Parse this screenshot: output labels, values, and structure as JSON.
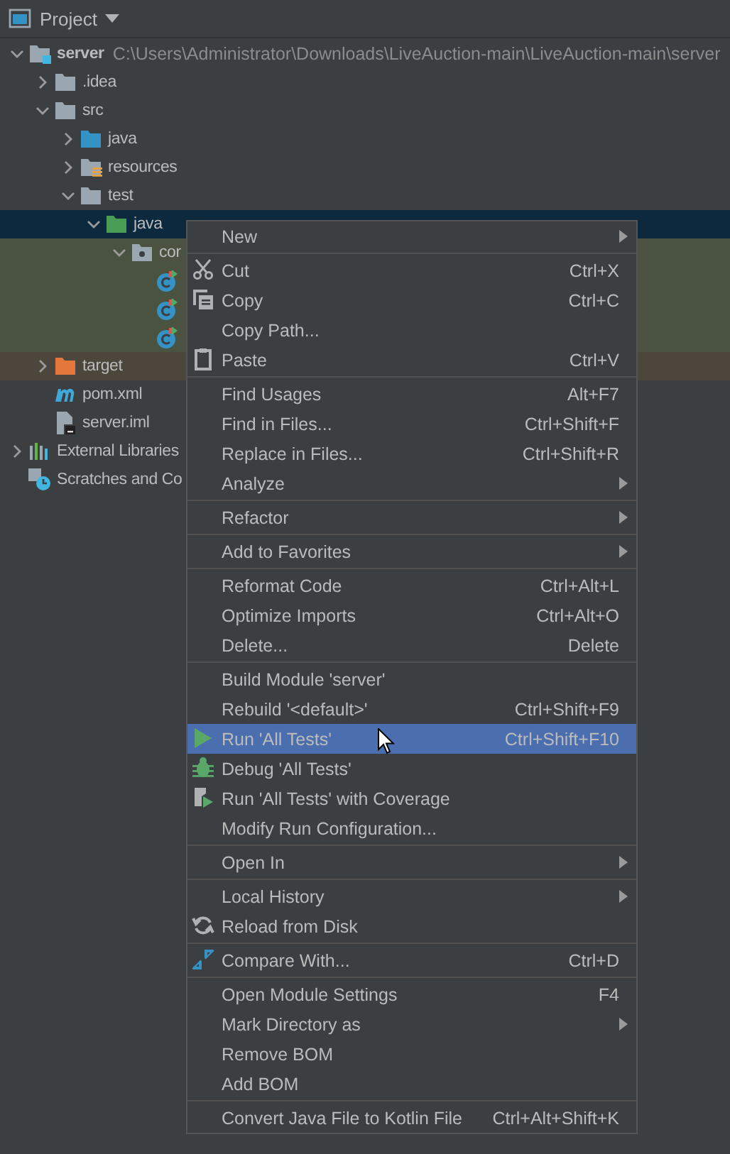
{
  "panel": {
    "title": "Project"
  },
  "tree": [
    {
      "kind": "module",
      "label": "server",
      "path": "C:\\Users\\Administrator\\Downloads\\LiveAuction-main\\LiveAuction-main\\server",
      "expanded": true,
      "selected": false,
      "children": [
        {
          "kind": "folder",
          "label": ".idea",
          "expanded": false,
          "selected": false
        },
        {
          "kind": "folder",
          "label": "src",
          "expanded": true,
          "selected": false,
          "children": [
            {
              "kind": "source-folder",
              "label": "java",
              "expanded": false,
              "selected": false
            },
            {
              "kind": "resources-folder",
              "label": "resources",
              "expanded": false,
              "selected": false
            },
            {
              "kind": "folder",
              "label": "test",
              "expanded": true,
              "selected": false,
              "children": [
                {
                  "kind": "test-folder",
                  "label": "java",
                  "expanded": true,
                  "selected": true,
                  "children": [
                    {
                      "kind": "package",
                      "label": "cor",
                      "expanded": true,
                      "selected": false,
                      "test": true,
                      "children": [
                        {
                          "kind": "test-class",
                          "selected": false,
                          "test": true
                        },
                        {
                          "kind": "test-class",
                          "selected": false,
                          "test": true
                        },
                        {
                          "kind": "test-class",
                          "selected": false,
                          "test": true
                        }
                      ]
                    }
                  ]
                }
              ]
            }
          ]
        },
        {
          "kind": "excluded-folder",
          "label": "target",
          "expanded": false,
          "selected": false,
          "excluded": true
        },
        {
          "kind": "maven-file",
          "label": "pom.xml",
          "selected": false
        },
        {
          "kind": "iml-file",
          "label": "server.iml",
          "selected": false
        }
      ]
    },
    {
      "kind": "libraries",
      "label": "External Libraries",
      "expanded": false,
      "selected": false
    },
    {
      "kind": "scratches",
      "label": "Scratches and Co",
      "selected": false
    }
  ],
  "menu": [
    [
      {
        "label": "New",
        "submenu": true,
        "selected": false
      }
    ],
    [
      {
        "label": "Cut",
        "shortcut": "Ctrl+X",
        "selected": false
      },
      {
        "label": "Copy",
        "shortcut": "Ctrl+C",
        "selected": false
      },
      {
        "label": "Copy Path...",
        "selected": false
      },
      {
        "label": "Paste",
        "shortcut": "Ctrl+V",
        "selected": false
      }
    ],
    [
      {
        "label": "Find Usages",
        "shortcut": "Alt+F7",
        "selected": false
      },
      {
        "label": "Find in Files...",
        "shortcut": "Ctrl+Shift+F",
        "selected": false
      },
      {
        "label": "Replace in Files...",
        "shortcut": "Ctrl+Shift+R",
        "selected": false
      },
      {
        "label": "Analyze",
        "submenu": true,
        "selected": false
      }
    ],
    [
      {
        "label": "Refactor",
        "submenu": true,
        "selected": false
      }
    ],
    [
      {
        "label": "Add to Favorites",
        "submenu": true,
        "selected": false
      }
    ],
    [
      {
        "label": "Reformat Code",
        "shortcut": "Ctrl+Alt+L",
        "selected": false
      },
      {
        "label": "Optimize Imports",
        "shortcut": "Ctrl+Alt+O",
        "selected": false
      },
      {
        "label": "Delete...",
        "shortcut": "Delete",
        "selected": false
      }
    ],
    [
      {
        "label": "Build Module 'server'",
        "selected": false
      },
      {
        "label": "Rebuild '<default>'",
        "shortcut": "Ctrl+Shift+F9",
        "selected": false
      },
      {
        "label": "Run 'All Tests'",
        "shortcut": "Ctrl+Shift+F10",
        "selected": true
      },
      {
        "label": "Debug 'All Tests'",
        "selected": false
      },
      {
        "label": "Run 'All Tests' with Coverage",
        "selected": false
      },
      {
        "label": "Modify Run Configuration...",
        "selected": false
      }
    ],
    [
      {
        "label": "Open In",
        "submenu": true,
        "selected": false
      }
    ],
    [
      {
        "label": "Local History",
        "submenu": true,
        "selected": false
      },
      {
        "label": "Reload from Disk",
        "selected": false
      }
    ],
    [
      {
        "label": "Compare With...",
        "shortcut": "Ctrl+D",
        "selected": false
      }
    ],
    [
      {
        "label": "Open Module Settings",
        "shortcut": "F4",
        "selected": false
      },
      {
        "label": "Mark Directory as",
        "submenu": true,
        "selected": false
      },
      {
        "label": "Remove BOM",
        "selected": false
      },
      {
        "label": "Add BOM",
        "selected": false
      }
    ],
    [
      {
        "label": "Convert Java File to Kotlin File",
        "shortcut": "Ctrl+Alt+Shift+K",
        "selected": false
      }
    ]
  ]
}
